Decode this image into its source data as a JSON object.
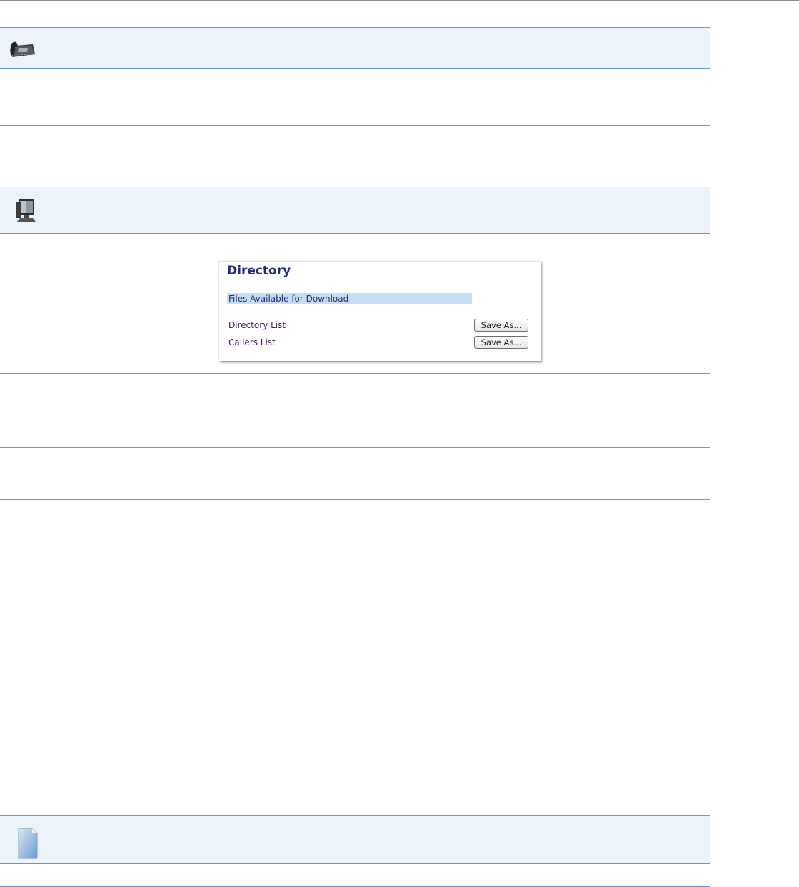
{
  "directory_panel": {
    "title": "Directory",
    "section_label": "Files Available for Download",
    "rows": [
      {
        "label": "Directory List",
        "button_label": "Save As..."
      },
      {
        "label": "Callers List",
        "button_label": "Save As..."
      }
    ]
  },
  "icons": {
    "band1": "desk-phone-icon",
    "band2": "computer-icon",
    "band3": "document-icon"
  },
  "colors": {
    "rule": "#5d9dd4",
    "band_fill": "#edf3fa",
    "title_text": "#1f2d7a",
    "section_fill": "#c7ddf3"
  }
}
